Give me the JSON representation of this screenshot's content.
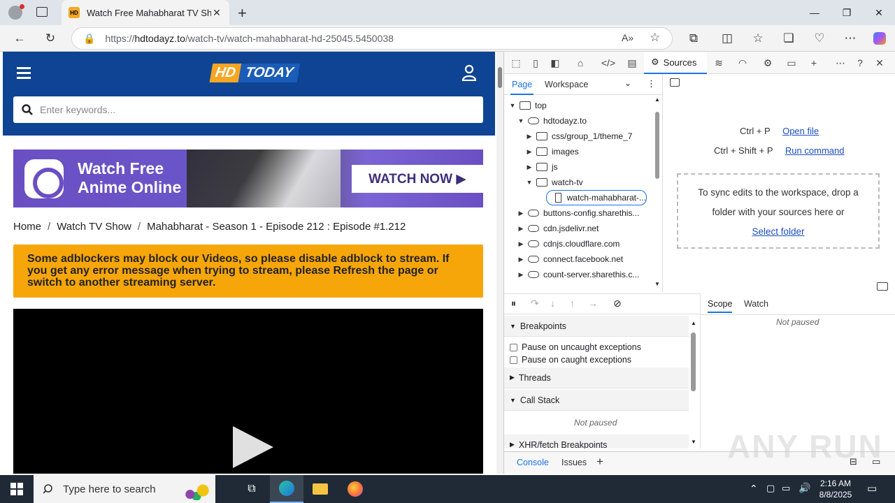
{
  "browser": {
    "tab_title": "Watch Free Mahabharat TV Show",
    "tab_favicon_text": "HD",
    "url_host": "hdtodayz.to",
    "url_prefix": "https://",
    "url_path": "/watch-tv/watch-mahabharat-hd-25045.5450038"
  },
  "site": {
    "logo_hd": "HD",
    "logo_today": "TODAY",
    "search_placeholder": "Enter keywords...",
    "banner": {
      "line1": "Watch Free",
      "line2": "Anime Online",
      "button": "WATCH NOW ▶"
    },
    "breadcrumb": [
      "Home",
      "Watch TV Show",
      "Mahabharat - Season 1 - Episode 212 : Episode #1.212"
    ],
    "alert": "Some adblockers may block our Videos, so please disable adblock to stream. If you get any error message when trying to stream, please Refresh the page or switch to another streaming server."
  },
  "devtools": {
    "active_tab": "Sources",
    "nav_tabs": [
      "Page",
      "Workspace"
    ],
    "tree": [
      {
        "label": "top",
        "depth": 0,
        "icon": "frame",
        "expanded": true
      },
      {
        "label": "hdtodayz.to",
        "depth": 1,
        "icon": "cloud",
        "expanded": true
      },
      {
        "label": "css/group_1/theme_7",
        "depth": 2,
        "icon": "folder",
        "expanded": false
      },
      {
        "label": "images",
        "depth": 2,
        "icon": "folder",
        "expanded": false
      },
      {
        "label": "js",
        "depth": 2,
        "icon": "folder",
        "expanded": false
      },
      {
        "label": "watch-tv",
        "depth": 2,
        "icon": "folder",
        "expanded": true
      },
      {
        "label": "watch-mahabharat-...",
        "depth": 3,
        "icon": "file",
        "selected": true
      },
      {
        "label": "buttons-config.sharethis...",
        "depth": 1,
        "icon": "cloud",
        "expanded": false
      },
      {
        "label": "cdn.jsdelivr.net",
        "depth": 1,
        "icon": "cloud",
        "expanded": false
      },
      {
        "label": "cdnjs.cloudflare.com",
        "depth": 1,
        "icon": "cloud",
        "expanded": false
      },
      {
        "label": "connect.facebook.net",
        "depth": 1,
        "icon": "cloud",
        "expanded": false
      },
      {
        "label": "count-server.sharethis.c...",
        "depth": 1,
        "icon": "cloud",
        "expanded": false
      }
    ],
    "shortcuts": [
      {
        "keys": "Ctrl + P",
        "action": "Open file"
      },
      {
        "keys": "Ctrl + Shift + P",
        "action": "Run command"
      }
    ],
    "dropzone_text": "To sync edits to the workspace, drop a folder with your sources here or",
    "dropzone_link": "Select folder",
    "breakpoints_title": "Breakpoints",
    "pause_uncaught": "Pause on uncaught exceptions",
    "pause_caught": "Pause on caught exceptions",
    "threads": "Threads",
    "call_stack": "Call Stack",
    "not_paused": "Not paused",
    "xhr": "XHR/fetch Breakpoints",
    "scope_tabs": [
      "Scope",
      "Watch"
    ],
    "scope_status": "Not paused",
    "drawer_tabs": [
      "Console",
      "Issues"
    ]
  },
  "taskbar": {
    "search_placeholder": "Type here to search",
    "time": "2:16 AM",
    "date": "8/8/2025"
  },
  "watermark": "ANY RUN"
}
